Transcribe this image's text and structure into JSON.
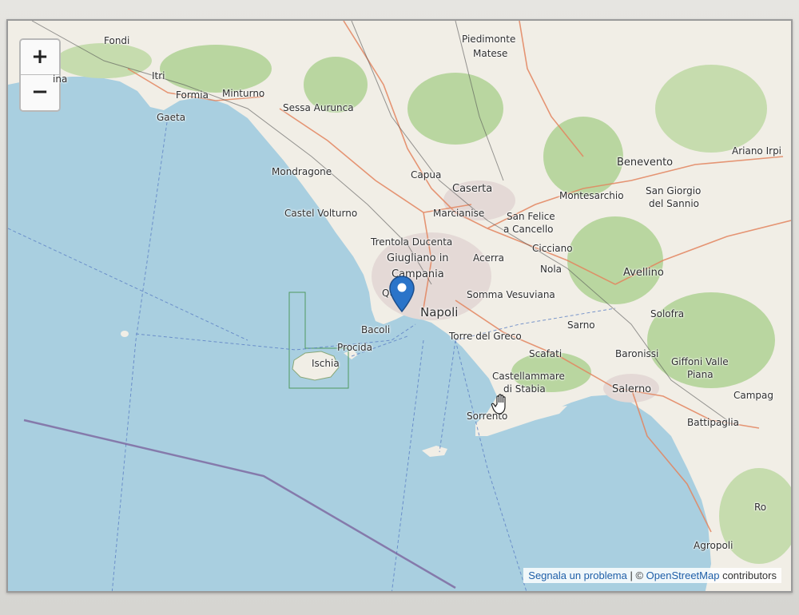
{
  "map": {
    "zoom_in_label": "+",
    "zoom_out_label": "−",
    "places": [
      {
        "id": "fondi",
        "name": "Fondi"
      },
      {
        "id": "itri",
        "name": "Itri"
      },
      {
        "id": "formia",
        "name": "Formia"
      },
      {
        "id": "minturno",
        "name": "Minturno"
      },
      {
        "id": "gaeta",
        "name": "Gaeta"
      },
      {
        "id": "terracina",
        "name": "ina"
      },
      {
        "id": "piedimonte",
        "name": "Piedimonte"
      },
      {
        "id": "matese",
        "name": "Matese"
      },
      {
        "id": "sessa",
        "name": "Sessa Aurunca"
      },
      {
        "id": "mondragone",
        "name": "Mondragone"
      },
      {
        "id": "capua",
        "name": "Capua"
      },
      {
        "id": "caserta",
        "name": "Caserta"
      },
      {
        "id": "benevento",
        "name": "Benevento"
      },
      {
        "id": "ariano",
        "name": "Ariano Irpi"
      },
      {
        "id": "montesarchio",
        "name": "Montesarchio"
      },
      {
        "id": "sangiorgio1",
        "name": "San Giorgio"
      },
      {
        "id": "sangiorgio2",
        "name": "del Sannio"
      },
      {
        "id": "castelvolturno",
        "name": "Castel Volturno"
      },
      {
        "id": "marcianise",
        "name": "Marcianise"
      },
      {
        "id": "sanfelice1",
        "name": "San Felice"
      },
      {
        "id": "sanfelice2",
        "name": "a Cancello"
      },
      {
        "id": "trentola",
        "name": "Trentola Ducenta"
      },
      {
        "id": "cicciano",
        "name": "Cicciano"
      },
      {
        "id": "giugliano1",
        "name": "Giugliano in"
      },
      {
        "id": "giugliano2",
        "name": "Campania"
      },
      {
        "id": "acerra",
        "name": "Acerra"
      },
      {
        "id": "nola",
        "name": "Nola"
      },
      {
        "id": "avellino",
        "name": "Avellino"
      },
      {
        "id": "somma",
        "name": "Somma Vesuviana"
      },
      {
        "id": "napoli",
        "name": "Napoli"
      },
      {
        "id": "qu",
        "name": "Qu"
      },
      {
        "id": "bacoli",
        "name": "Bacoli"
      },
      {
        "id": "procida",
        "name": "Procida"
      },
      {
        "id": "ischia",
        "name": "Ischia"
      },
      {
        "id": "torredelgreco",
        "name": "Torre del Greco"
      },
      {
        "id": "sarno",
        "name": "Sarno"
      },
      {
        "id": "solofra",
        "name": "Solofra"
      },
      {
        "id": "scafati",
        "name": "Scafati"
      },
      {
        "id": "baronissi",
        "name": "Baronissi"
      },
      {
        "id": "giffoni1",
        "name": "Giffoni Valle"
      },
      {
        "id": "giffoni2",
        "name": "Piana"
      },
      {
        "id": "castellammare1",
        "name": "Castellammare"
      },
      {
        "id": "castellammare2",
        "name": "di Stabia"
      },
      {
        "id": "salerno",
        "name": "Salerno"
      },
      {
        "id": "campagna",
        "name": "Campag"
      },
      {
        "id": "sorrento",
        "name": "Sorrento"
      },
      {
        "id": "battipaglia",
        "name": "Battipaglia"
      },
      {
        "id": "ro",
        "name": "Ro"
      },
      {
        "id": "agropoli",
        "name": "Agropoli"
      }
    ],
    "attribution": {
      "report_link": "Segnala un problema",
      "separator": " | © ",
      "osm_link": "OpenStreetMap",
      "suffix": " contributors"
    }
  },
  "colors": {
    "sea": "#a9cfe0",
    "land": "#f1eee6",
    "forest": "#b9d6a0",
    "urban": "#e4d9d6",
    "road": "#e3855f",
    "marker": "#2a74c9"
  }
}
